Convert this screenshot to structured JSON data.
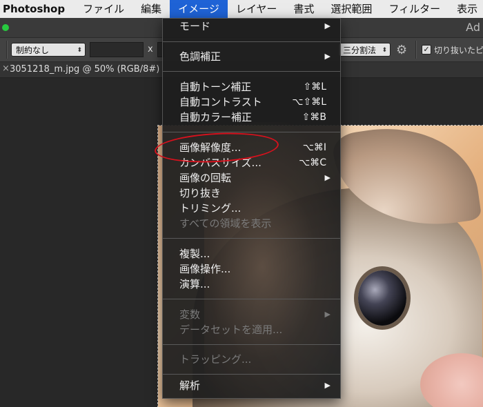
{
  "menubar": {
    "app": "Photoshop",
    "items": [
      "ファイル",
      "編集",
      "イメージ",
      "レイヤー",
      "書式",
      "選択範囲",
      "フィルター",
      "表示"
    ]
  },
  "titlestrip": {
    "app_title": "Ad"
  },
  "optbar": {
    "style_value": "制約なし",
    "x_label": "x",
    "grid_value": "三分割法",
    "checkbox_label": "切り抜いたピ",
    "checkbox_mark": "✓"
  },
  "tab": {
    "close": "×",
    "title": "3051218_m.jpg @ 50% (RGB/8#)"
  },
  "menu": {
    "items": [
      {
        "label": "モード",
        "submenu": true
      },
      {
        "label": "色調補正",
        "submenu": true
      },
      {
        "label": "自動トーン補正",
        "shortcut": "⇧⌘L"
      },
      {
        "label": "自動コントラスト",
        "shortcut": "⌥⇧⌘L"
      },
      {
        "label": "自動カラー補正",
        "shortcut": "⇧⌘B"
      },
      {
        "label": "画像解像度...",
        "shortcut": "⌥⌘I"
      },
      {
        "label": "カンバスサイズ...",
        "shortcut": "⌥⌘C"
      },
      {
        "label": "画像の回転",
        "submenu": true
      },
      {
        "label": "切り抜き"
      },
      {
        "label": "トリミング..."
      },
      {
        "label": "すべての領域を表示",
        "disabled": true
      },
      {
        "label": "複製..."
      },
      {
        "label": "画像操作..."
      },
      {
        "label": "演算..."
      },
      {
        "label": "変数",
        "submenu": true,
        "disabled": true
      },
      {
        "label": "データセットを適用...",
        "disabled": true
      },
      {
        "label": "トラッピング...",
        "disabled": true
      },
      {
        "label": "解析",
        "submenu": true
      }
    ],
    "submenu_glyph": "▶"
  },
  "colors": {
    "menubar_highlight": "#1f63d6",
    "annotation_ring": "#d8111d"
  }
}
